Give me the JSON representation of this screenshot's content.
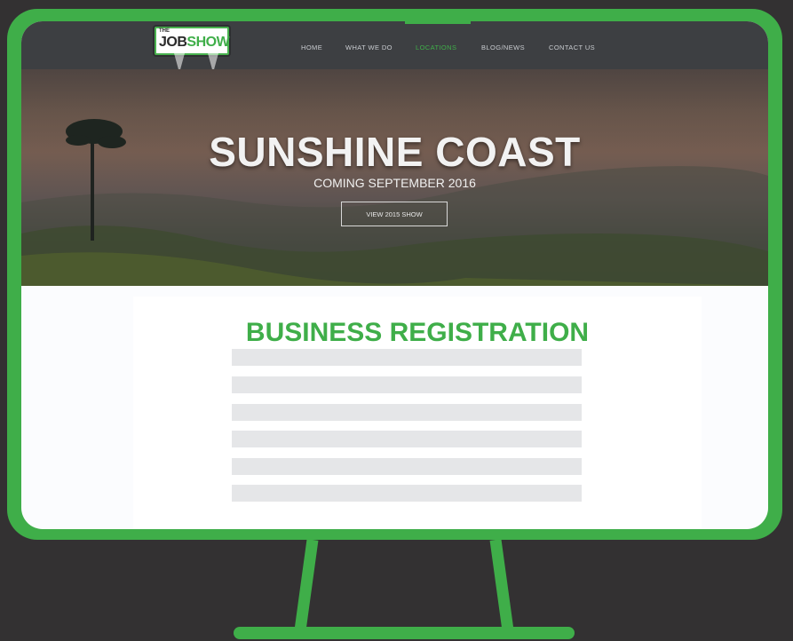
{
  "logo": {
    "top_text": "THE",
    "brand_prefix": "JOB",
    "brand_suffix": "SHOW"
  },
  "nav": {
    "items": [
      {
        "label": "HOME"
      },
      {
        "label": "WHAT WE DO"
      },
      {
        "label": "LOCATIONS"
      },
      {
        "label": "BLOG/NEWS"
      },
      {
        "label": "CONTACT US"
      }
    ],
    "active": "LOCATIONS"
  },
  "hero": {
    "title": "SUNSHINE COAST",
    "subtitle": "COMING SEPTEMBER 2016",
    "button_label": "VIEW 2015 SHOW"
  },
  "form": {
    "title": "BUSINESS REGISTRATION",
    "field_count": 6
  },
  "colors": {
    "accent": "#3fae49",
    "background": "#333132",
    "navbar": "#3d3f42",
    "field": "#e5e6e8"
  }
}
